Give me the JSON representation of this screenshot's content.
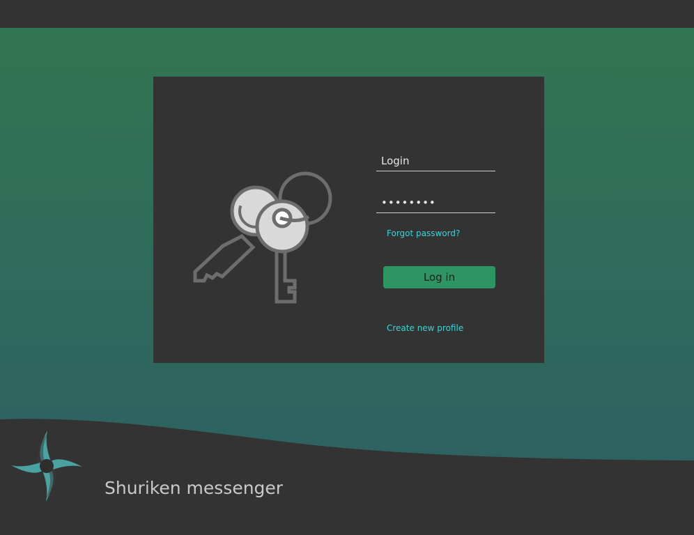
{
  "login": {
    "username_value": "Login",
    "password_value": "••••••••",
    "forgot_label": "Forgot password?",
    "login_button_label": "Log in",
    "create_profile_label": "Create new profile"
  },
  "footer": {
    "app_name": "Shuriken messenger"
  },
  "icons": {
    "hero": "keys-icon",
    "logo": "shuriken-logo-icon"
  },
  "colors": {
    "accent": "#2e9461",
    "link": "#38d6d6",
    "panel": "#333333",
    "logo": "#4aa3a0"
  }
}
